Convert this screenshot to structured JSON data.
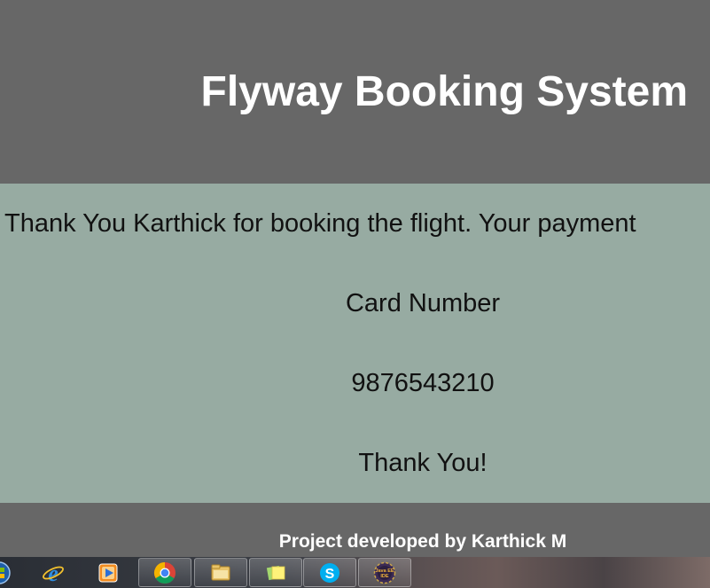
{
  "header": {
    "title": "Flyway Booking System"
  },
  "confirmation": {
    "message": "Thank You Karthick for booking the flight. Your payment",
    "card_label": "Card Number",
    "card_number": "9876543210",
    "closing": "Thank You!"
  },
  "footer": {
    "text": "Project developed by Karthick M"
  },
  "taskbar": {
    "items": [
      {
        "icon": "start-orb-icon"
      },
      {
        "icon": "internet-explorer-icon"
      },
      {
        "icon": "media-player-icon"
      },
      {
        "icon": "chrome-icon"
      },
      {
        "icon": "file-explorer-icon"
      },
      {
        "icon": "sticky-notes-icon"
      },
      {
        "icon": "skype-icon"
      },
      {
        "icon": "java-ee-ide-icon",
        "label": "Java EE IDE"
      }
    ]
  },
  "colors": {
    "header_bg": "#676767",
    "content_bg": "#97aba2",
    "title_text": "#ffffff",
    "body_text": "#111111"
  }
}
